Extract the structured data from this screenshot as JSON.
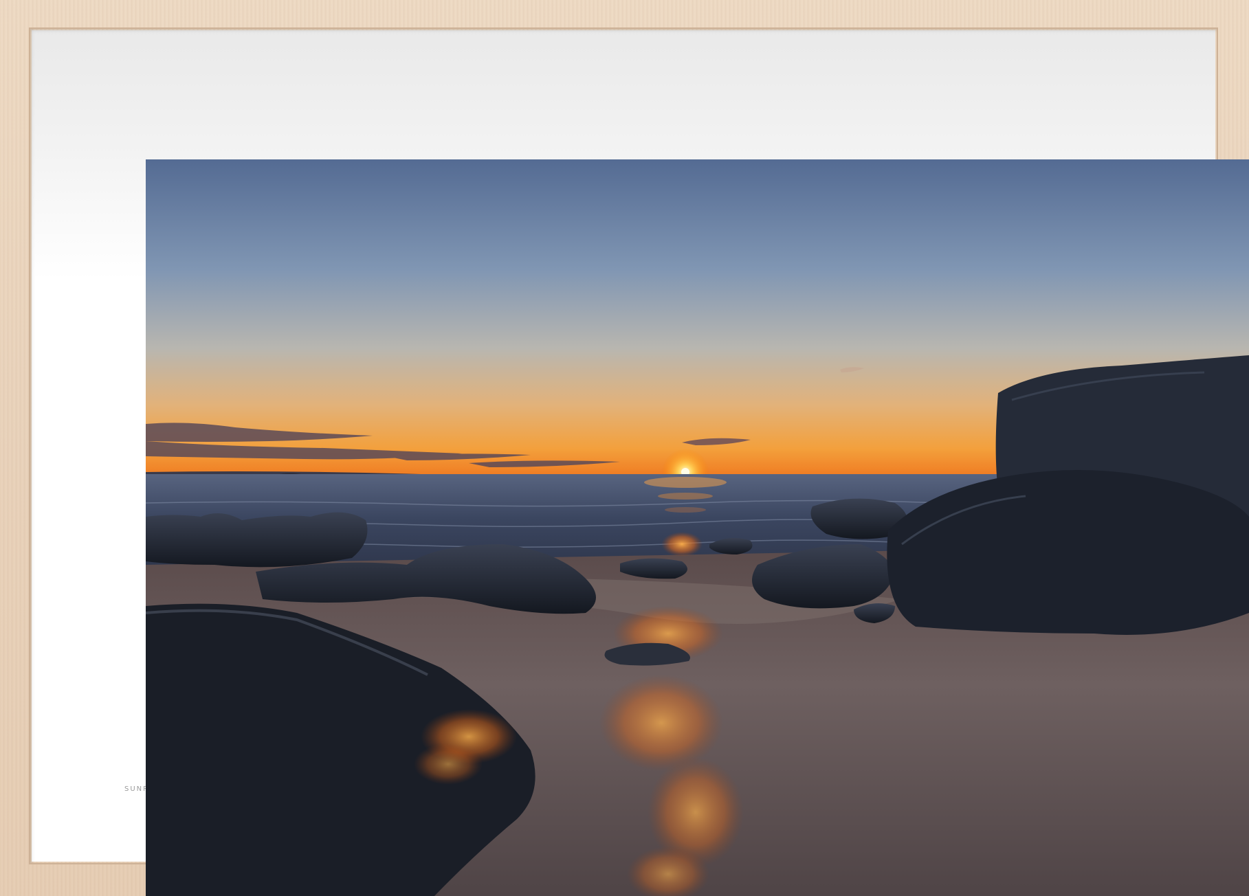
{
  "caption": {
    "text": "SUNR"
  },
  "colors": {
    "frame_wood": "#ead4bd",
    "mat": "#ffffff",
    "sky_top": "#5a6f95",
    "sky_horizon": "#f6a43a",
    "sun": "#fff2b0",
    "sea": "#3c4a64",
    "rock": "#1e2430",
    "sand": "#6a5a55"
  }
}
